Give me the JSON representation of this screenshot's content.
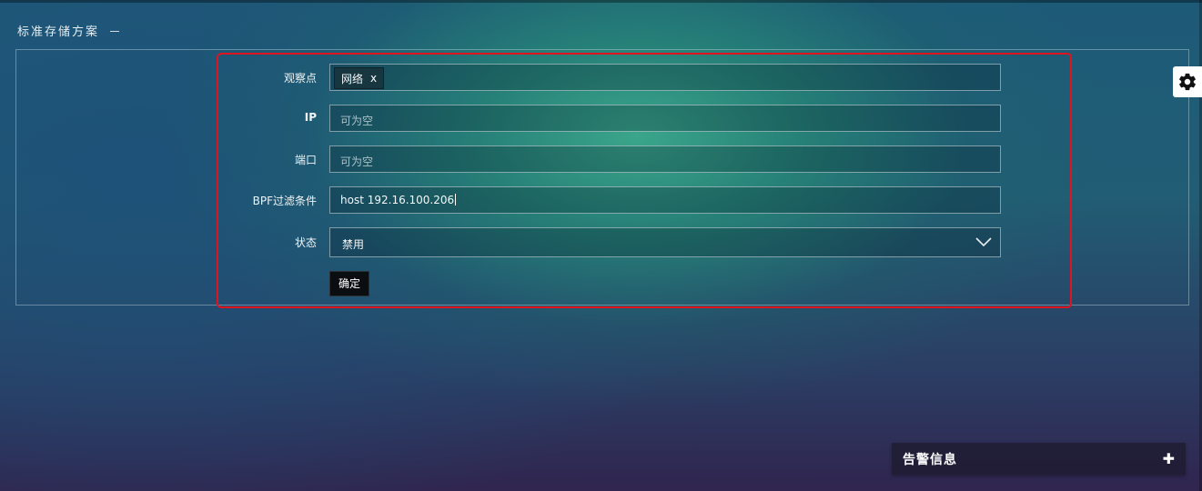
{
  "section": {
    "title": "标准存储方案",
    "collapse_symbol": "—"
  },
  "form": {
    "observation_point": {
      "label": "观察点",
      "tags": [
        "网络"
      ],
      "tag_remove": "x"
    },
    "ip": {
      "label": "IP",
      "placeholder": "可为空",
      "value": ""
    },
    "port": {
      "label": "端口",
      "placeholder": "可为空",
      "value": ""
    },
    "bpf_filter": {
      "label": "BPF过滤条件",
      "value": "host 192.16.100.206"
    },
    "status": {
      "label": "状态",
      "selected": "禁用"
    },
    "submit_label": "确定"
  },
  "settings": {
    "icon": "gear-icon"
  },
  "alarm_panel": {
    "title": "告警信息",
    "expand_symbol": "✚"
  },
  "colors": {
    "highlight_border": "#e0141e",
    "button_bg": "#0a0e10"
  }
}
